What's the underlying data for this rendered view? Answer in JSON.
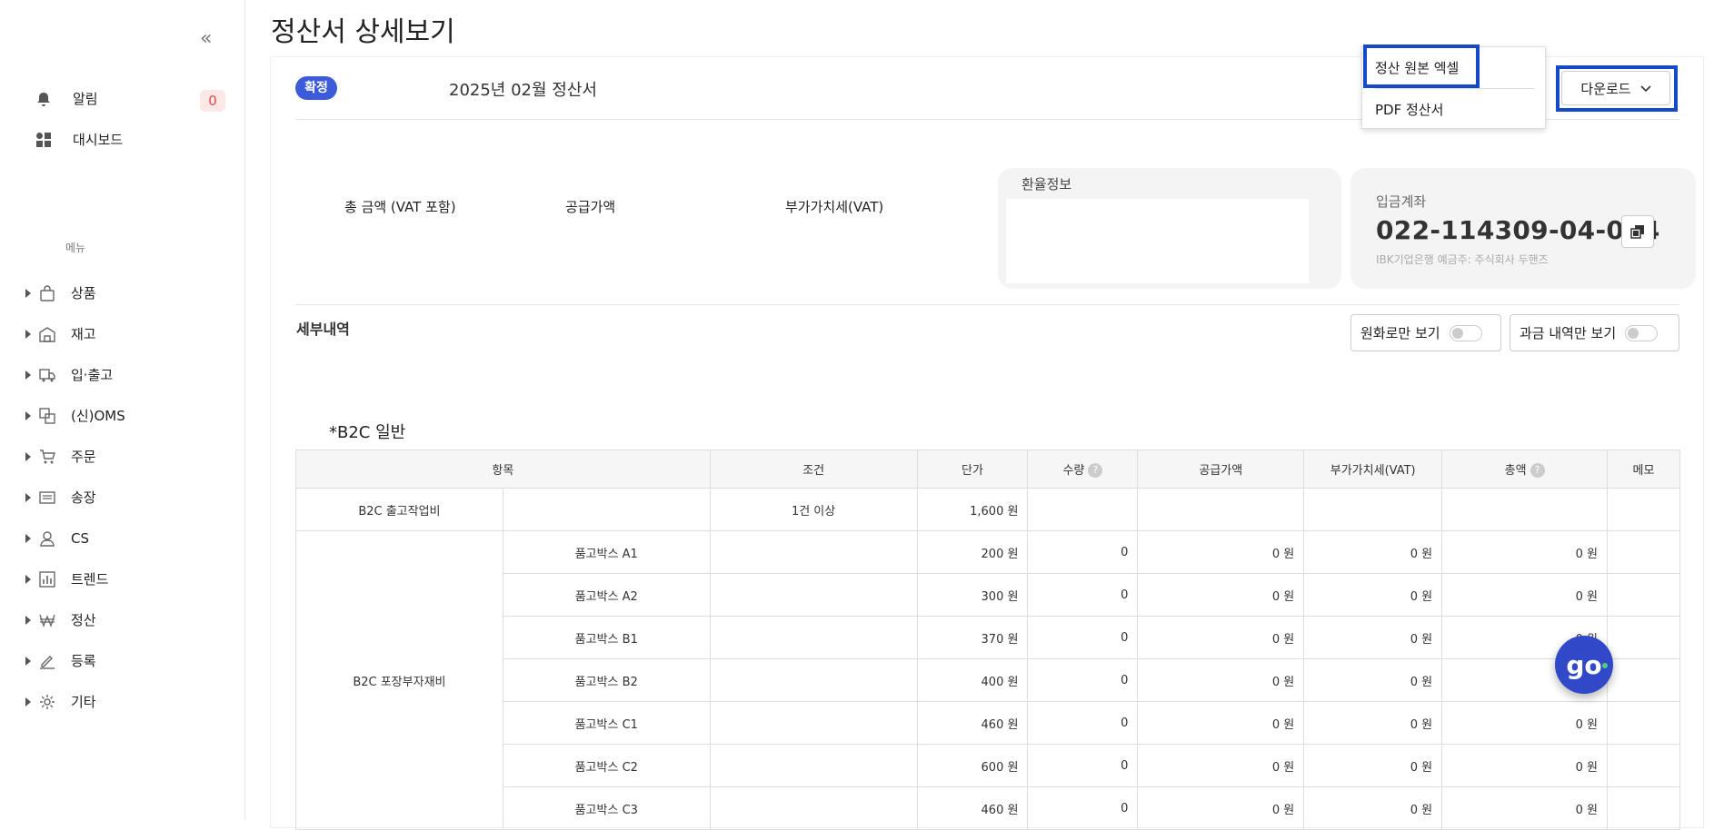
{
  "sidebar": {
    "collapse_icon": "«",
    "alarm_label": "알림",
    "alarm_count": "0",
    "dashboard_label": "대시보드",
    "menu_header": "메뉴",
    "items": [
      {
        "label": "상품",
        "icon": "bag-icon"
      },
      {
        "label": "재고",
        "icon": "warehouse-icon"
      },
      {
        "label": "입·출고",
        "icon": "truck-icon"
      },
      {
        "label": "(신)OMS",
        "icon": "exchange-icon"
      },
      {
        "label": "주문",
        "icon": "cart-icon"
      },
      {
        "label": "송장",
        "icon": "invoice-icon"
      },
      {
        "label": "CS",
        "icon": "user-icon"
      },
      {
        "label": "트렌드",
        "icon": "chart-icon"
      },
      {
        "label": "정산",
        "icon": "won-icon"
      },
      {
        "label": "등록",
        "icon": "edit-icon"
      },
      {
        "label": "기타",
        "icon": "gear-icon"
      }
    ]
  },
  "page": {
    "title": "정산서 상세보기",
    "status": "확정",
    "statement_title": "2025년 02월 정산서"
  },
  "download": {
    "button_label": "다운로드",
    "options": [
      "정산 원본 엑셀",
      "PDF 정산서"
    ]
  },
  "summary": {
    "total_label": "총 금액 (VAT 포함)",
    "supply_label": "공급가액",
    "vat_label": "부가가치세(VAT)",
    "exchange_title": "환율정보",
    "account_label": "입금계좌",
    "account_number": "022-114309-04-014",
    "account_bank": "IBK기업은행 예금주: 주식회사 두핸즈"
  },
  "details": {
    "title": "세부내역",
    "toggle_krw": "원화로만 보기",
    "toggle_charge": "과금 내역만 보기",
    "section_label": "*B2C 일반",
    "columns": [
      "항목",
      "조건",
      "단가",
      "수량",
      "공급가액",
      "부가가치세(VAT)",
      "총액",
      "메모"
    ],
    "row_first": {
      "item": "B2C 출고작업비",
      "sub": "",
      "condition": "1건 이상",
      "price": "1,600 원"
    },
    "group_label": "B2C 포장부자재비",
    "rows": [
      {
        "sub": "품고박스 A1",
        "price": "200 원",
        "qty": "0",
        "supply": "0 원",
        "vat": "0 원",
        "total": "0 원"
      },
      {
        "sub": "품고박스 A2",
        "price": "300 원",
        "qty": "0",
        "supply": "0 원",
        "vat": "0 원",
        "total": "0 원"
      },
      {
        "sub": "품고박스 B1",
        "price": "370 원",
        "qty": "0",
        "supply": "0 원",
        "vat": "0 원",
        "total": "0 원"
      },
      {
        "sub": "품고박스 B2",
        "price": "400 원",
        "qty": "0",
        "supply": "0 원",
        "vat": "0 원",
        "total": ""
      },
      {
        "sub": "품고박스 C1",
        "price": "460 원",
        "qty": "0",
        "supply": "0 원",
        "vat": "0 원",
        "total": "0 원"
      },
      {
        "sub": "품고박스 C2",
        "price": "600 원",
        "qty": "0",
        "supply": "0 원",
        "vat": "0 원",
        "total": "0 원"
      },
      {
        "sub": "품고박스 C3",
        "price": "460 원",
        "qty": "0",
        "supply": "0 원",
        "vat": "0 원",
        "total": "0 원"
      }
    ]
  },
  "chat_button": {
    "label": "go"
  }
}
